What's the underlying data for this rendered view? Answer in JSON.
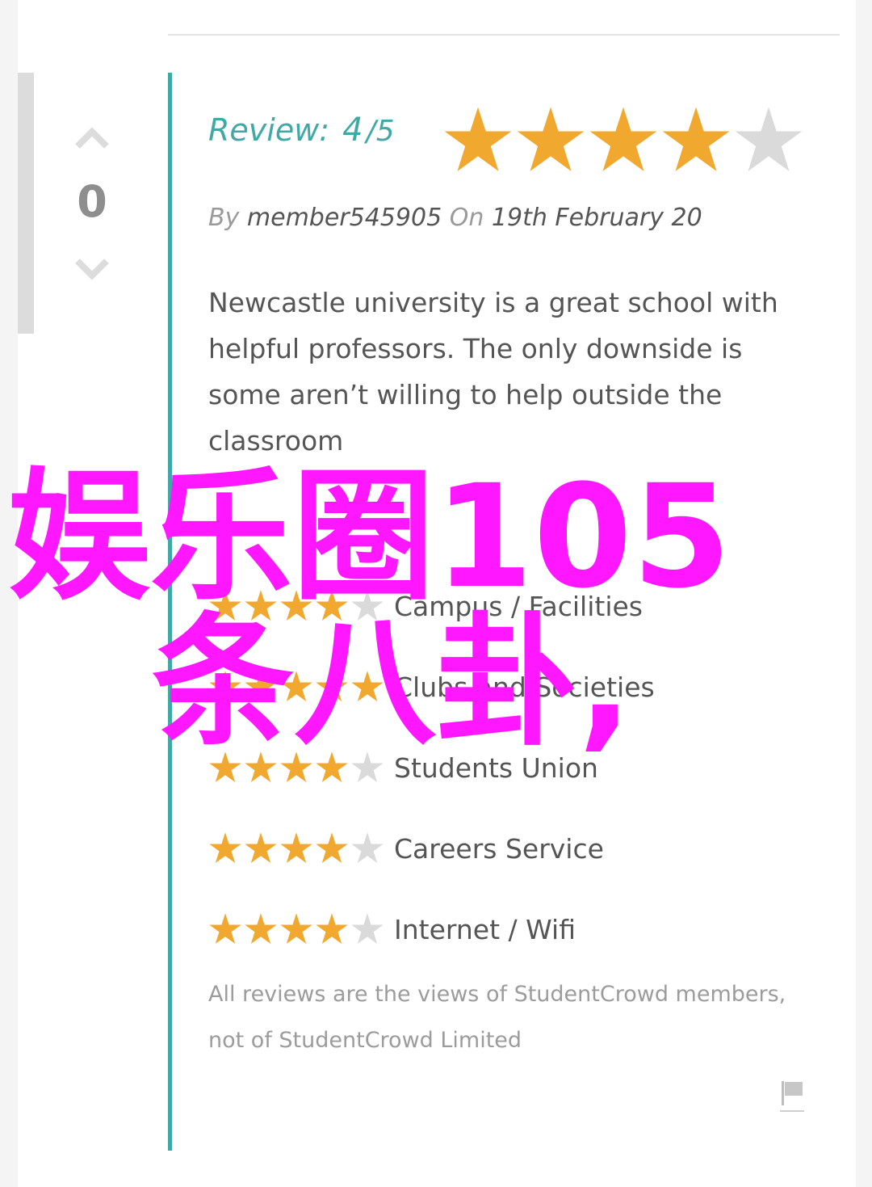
{
  "vote": {
    "count": "0"
  },
  "review": {
    "label": "Review:",
    "score": "4",
    "slash": "/",
    "out_of": "5",
    "rating": 4,
    "max_rating": 5,
    "byline_by": "By",
    "author": "member545905",
    "byline_on": "On",
    "date": "19th February 20",
    "body": "Newcastle university is a great school with helpful professors. The only downside is some aren’t willing to help outside the classroom"
  },
  "category_ratings": [
    {
      "label": "Campus / Facilities",
      "rating": 4
    },
    {
      "label": "Clubs and Societies",
      "rating": 5
    },
    {
      "label": "Students Union",
      "rating": 4
    },
    {
      "label": "Careers Service",
      "rating": 4
    },
    {
      "label": "Internet / Wifi",
      "rating": 4
    }
  ],
  "disclaimer": "All reviews are the views of StudentCrowd members, not of StudentCrowd Limited",
  "overlay": {
    "line1": "娱乐圈105",
    "line2": "条八卦,"
  },
  "colors": {
    "accent": "#3fa9a5",
    "star_on": "#f0a92e",
    "star_off": "#dadada",
    "overlay": "#ff18ff"
  }
}
